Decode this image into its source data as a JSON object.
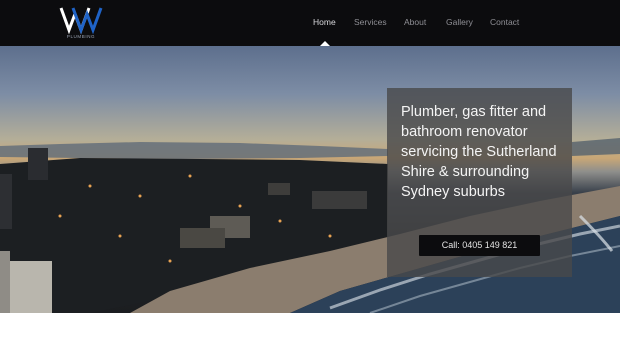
{
  "brand": {
    "logo_text": "PLUMBING",
    "colors": {
      "logo_primary": "#ffffff",
      "logo_accent": "#1f63c7"
    }
  },
  "nav": {
    "items": [
      {
        "label": "Home",
        "active": true
      },
      {
        "label": "Services",
        "active": false
      },
      {
        "label": "About",
        "active": false
      },
      {
        "label": "Gallery",
        "active": false
      },
      {
        "label": "Contact",
        "active": false
      }
    ]
  },
  "hero": {
    "headline": "Plumber, gas fitter and bathroom renovator servicing the Sutherland Shire & surrounding Sydney suburbs",
    "cta_label": "Call: 0405 149 821"
  }
}
